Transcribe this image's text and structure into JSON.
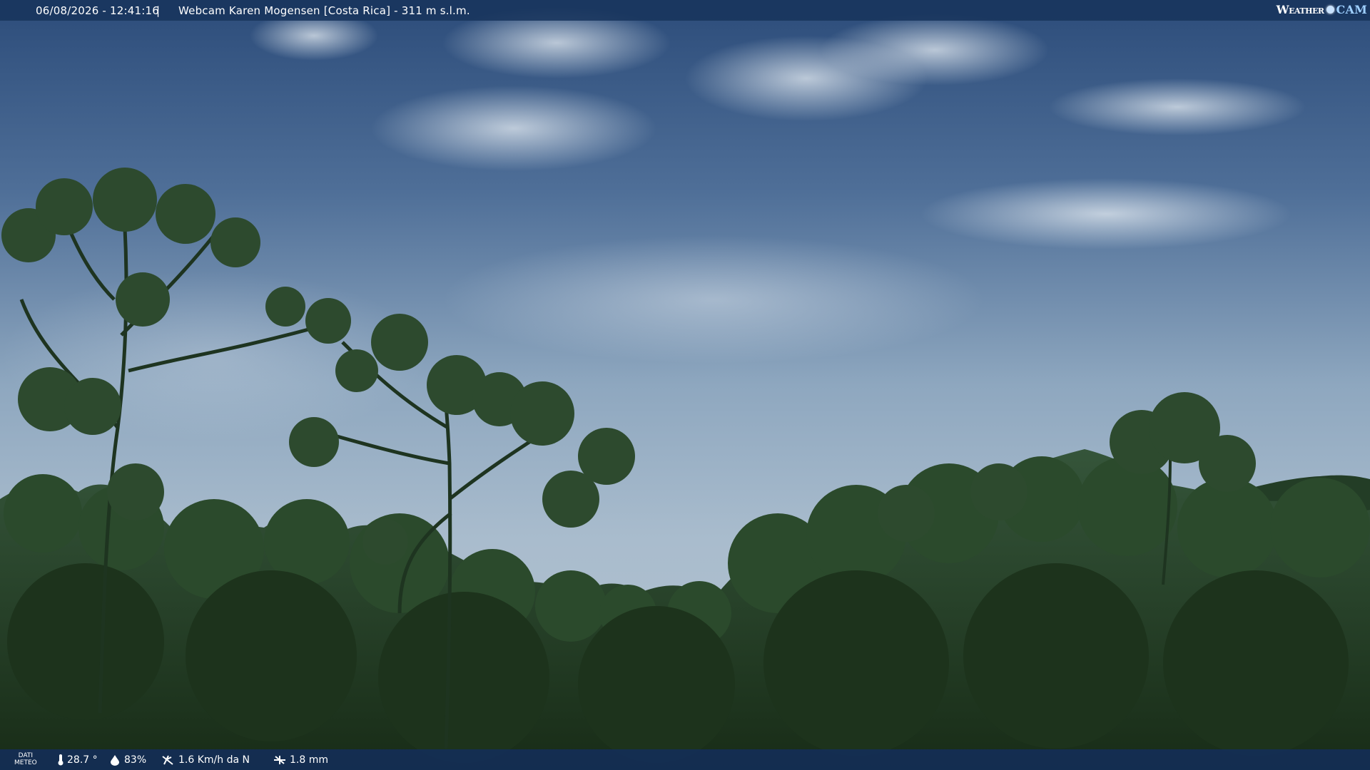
{
  "header": {
    "datetime": "06/08/2026 - 12:41:16",
    "separator": "|",
    "location": "Webcam Karen Mogensen [Costa Rica]  - 311 m s.l.m.",
    "brand_weather": "Weather",
    "brand_cam": "CAM"
  },
  "footer": {
    "label_line1": "DATI",
    "label_line2": "METEO",
    "temperature": "28.7 °",
    "humidity": "83%",
    "wind": "1.6 Km/h da N",
    "rain": "1.8 mm",
    "icons": [
      "thermometer-icon",
      "humidity-icon",
      "wind-icon",
      "rain-icon"
    ]
  },
  "colors": {
    "bar": "#18345c",
    "sky_top": "#2e4f7d",
    "sky_mid": "#9fb5c8",
    "forest": "#1f3a1d"
  }
}
